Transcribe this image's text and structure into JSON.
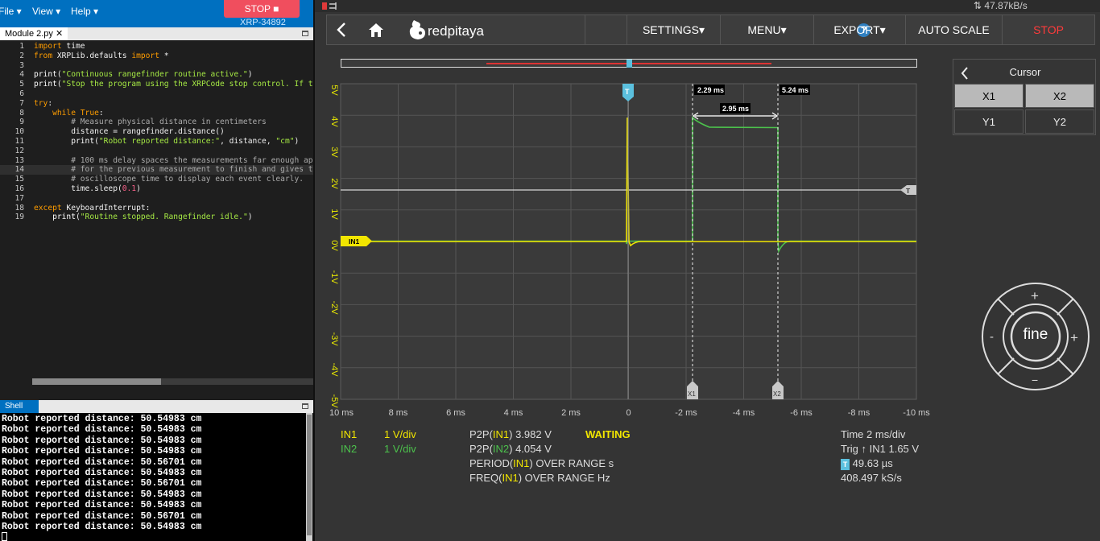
{
  "ide": {
    "menu": {
      "file": "File ▾",
      "view": "View ▾",
      "help": "Help ▾"
    },
    "stop_label": "STOP ■",
    "device": "XRP-34892",
    "tab": "Module 2.py ✕",
    "shell_tab": "Shell",
    "code": [
      {
        "n": "1",
        "html": "<span class='kw'>import</span><span class='tx'> time</span>"
      },
      {
        "n": "2",
        "html": "<span class='kw'>from</span><span class='tx'> XRPLib.defaults </span><span class='kw'>import</span><span class='tx'> *</span>"
      },
      {
        "n": "3",
        "html": ""
      },
      {
        "n": "4",
        "html": "<span class='fn'>print</span><span class='tx'>(</span><span class='str'>\"Continuous rangefinder routine active.\"</span><span class='tx'>)</span>"
      },
      {
        "n": "5",
        "html": "<span class='fn'>print</span><span class='tx'>(</span><span class='str'>\"Stop the program using the XRPCode stop control. If t</span>"
      },
      {
        "n": "6",
        "html": ""
      },
      {
        "n": "7",
        "html": "<span class='kw'>try</span><span class='tx'>:</span>"
      },
      {
        "n": "8",
        "html": "<span class='tx'>    </span><span class='kw'>while</span><span class='tx'> </span><span class='kw'>True</span><span class='tx'>:</span>"
      },
      {
        "n": "9",
        "html": "<span class='cm'>        # Measure physical distance in centimeters</span>"
      },
      {
        "n": "10",
        "html": "<span class='tx'>        distance = rangefinder.distance()</span>"
      },
      {
        "n": "11",
        "html": "<span class='tx'>        </span><span class='fn'>print</span><span class='tx'>(</span><span class='str'>\"Robot reported distance:\"</span><span class='tx'>, distance, </span><span class='str'>\"cm\"</span><span class='tx'>)</span>"
      },
      {
        "n": "12",
        "html": ""
      },
      {
        "n": "13",
        "html": "<span class='cm'>        # 100 ms delay spaces the measurements far enough ap</span>"
      },
      {
        "n": "14",
        "html": "<span class='cm'>        # for the previous measurement to finish and gives t</span>"
      },
      {
        "n": "15",
        "html": "<span class='cm'>        # oscilloscope time to display each event clearly.</span>"
      },
      {
        "n": "16",
        "html": "<span class='tx'>        time.sleep(</span><span class='num'>0.1</span><span class='tx'>)</span>"
      },
      {
        "n": "17",
        "html": ""
      },
      {
        "n": "18",
        "html": "<span class='kw'>except</span><span class='tx'> KeyboardInterrupt:</span>"
      },
      {
        "n": "19",
        "html": "<span class='tx'>    </span><span class='fn'>print</span><span class='tx'>(</span><span class='str'>\"Routine stopped. Rangefinder idle.\"</span><span class='tx'>)</span>"
      }
    ],
    "active_line": "14",
    "shell_lines": [
      "Robot reported distance: 50.54983 cm",
      "Robot reported distance: 50.54983 cm",
      "Robot reported distance: 50.54983 cm",
      "Robot reported distance: 50.54983 cm",
      "Robot reported distance: 50.56701 cm",
      "Robot reported distance: 50.54983 cm",
      "Robot reported distance: 50.56701 cm",
      "Robot reported distance: 50.54983 cm",
      "Robot reported distance: 50.54983 cm",
      "Robot reported distance: 50.56701 cm",
      "Robot reported distance: 50.54983 cm"
    ]
  },
  "scope": {
    "rate": "⇅ 47.87kB/s",
    "logo": "redpitaya",
    "help": "?",
    "nav": {
      "settings": "SETTINGS▾",
      "menu": "MENU▾",
      "export": "EXPORT▾",
      "autoscale": "AUTO SCALE",
      "stop": "STOP"
    },
    "time_labels": [
      "10 ms",
      "8 ms",
      "6 ms",
      "4 ms",
      "2 ms",
      "0",
      "-2 ms",
      "-4 ms",
      "-6 ms",
      "-8 ms",
      "-10 ms"
    ],
    "volt_labels": [
      "5V",
      "4V",
      "3V",
      "2V",
      "1V",
      "0V",
      "-1V",
      "-2V",
      "-3V",
      "-4V",
      "-5V"
    ],
    "markers": {
      "trigger": "T",
      "in1": "IN1",
      "x1": "X1",
      "x2": "X2",
      "t_right": "T"
    },
    "cursor_readouts": {
      "x1": "2.29 ms",
      "x2": "5.24 ms",
      "delta": "2.95 ms"
    },
    "channels": [
      {
        "name": "IN1",
        "scale": "1 V/div",
        "color": "#f2e600"
      },
      {
        "name": "IN2",
        "scale": "1 V/div",
        "color": "#4cc24c"
      }
    ],
    "measurements": {
      "p2p1_pre": "P2P(",
      "p2p1_ch": "IN1",
      "p2p1_post": ") 3.982 V",
      "p2p2_pre": "P2P(",
      "p2p2_ch": "IN2",
      "p2p2_post": ") 4.054 V",
      "period_pre": "PERIOD(",
      "period_ch": "IN1",
      "period_post": ") OVER RANGE s",
      "freq_pre": "FREQ(",
      "freq_ch": "IN1",
      "freq_post": ") OVER RANGE Hz",
      "status": "WAITING"
    },
    "timebase": {
      "time": "Time 2 ms/div",
      "trig": "Trig ↑ IN1 1.65 V",
      "offset": "49.63 µs",
      "rate": "408.497 kS/s",
      "offset_badge": "T"
    },
    "cursor_panel": {
      "title": "Cursor",
      "x1": "X1",
      "x2": "X2",
      "y1": "Y1",
      "y2": "Y2"
    },
    "knob": {
      "label": "fine",
      "plus": "+",
      "minus": "−",
      "left": "-",
      "right": "+"
    }
  }
}
